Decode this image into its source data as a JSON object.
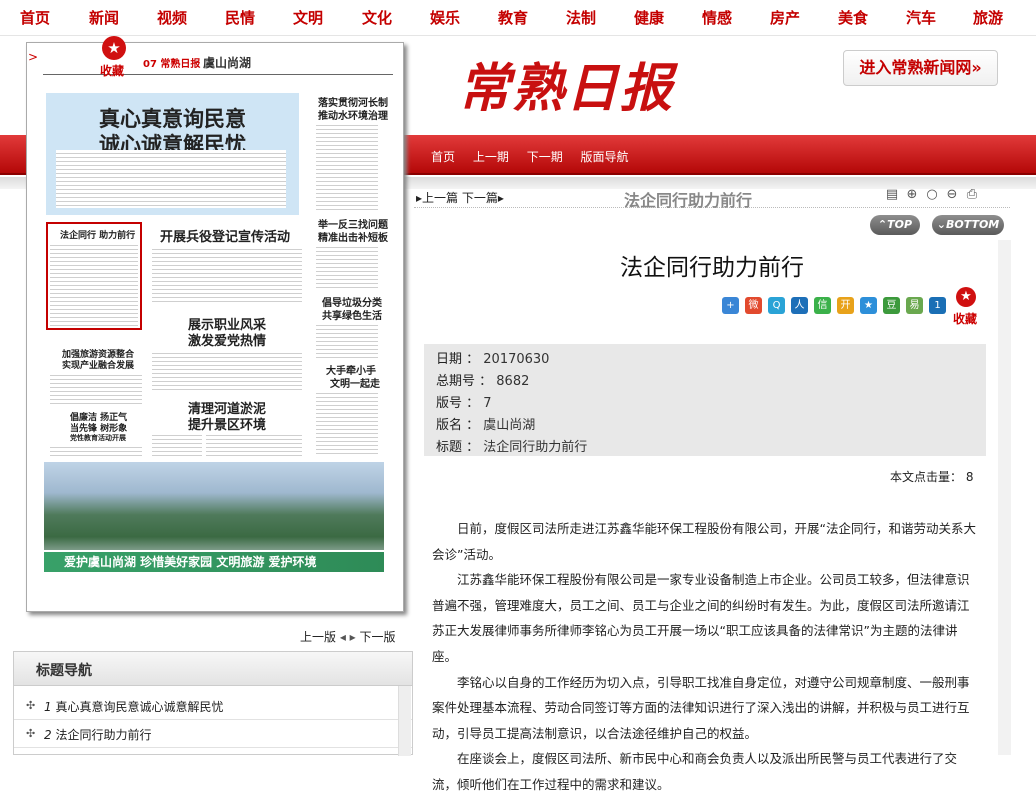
{
  "topnav": [
    "首页",
    "新闻",
    "视频",
    "民情",
    "文明",
    "文化",
    "娱乐",
    "教育",
    "法制",
    "健康",
    "情感",
    "房产",
    "美食",
    "汽车",
    "旅游"
  ],
  "masthead": "常熟日报",
  "visit_link": "进入常熟新闻网»",
  "subnav": [
    "首页",
    "上一期",
    "下一期",
    "版面导航"
  ],
  "paper": {
    "bookmark_label": "收藏",
    "page_no": "07 常熟日报",
    "page_name": "虞山尚湖",
    "lead_line1": "真心真意询民意",
    "lead_line2": "诚心诚意解民忧",
    "h_legal": "法企同行  助力前行",
    "h_enlist": "开展兵役登记宣传活动",
    "h_job1": "展示职业风采",
    "h_job2": "激发爱党热情",
    "h_river1": "清理河道淤泥",
    "h_river2": "提升景区环境",
    "h_side1a": "落实贯彻河长制",
    "h_side1b": "推动水环境治理",
    "h_side2a": "举一反三找问题",
    "h_side2b": "精准出击补短板",
    "h_side3a": "倡导垃圾分类",
    "h_side3b": "共享绿色生活",
    "h_side4a": "大手牵小手",
    "h_side4b": "文明一起走",
    "h_left1a": "加强旅游资源整合",
    "h_left1b": "实现产业融合发展",
    "h_left2a": "倡廉洁 扬正气",
    "h_left2b": "当先锋 树形象",
    "h_left2c": "党性教育活动开展",
    "banner": "爱护虞山尚湖  珍惜美好家园  文明旅游  爱护环境"
  },
  "pagenav": {
    "prev": "上一版",
    "next": "下一版"
  },
  "title_nav": {
    "heading": "标题导航",
    "items": [
      {
        "num": "1",
        "title": "真心真意询民意诚心诚意解民忧"
      },
      {
        "num": "2",
        "title": "法企同行助力前行"
      }
    ]
  },
  "article_bar": {
    "prev": "上一篇",
    "next": "下一篇",
    "subject": "法企同行助力前行"
  },
  "buttons": {
    "top": "TOP",
    "bottom": "BOTTOM"
  },
  "article": {
    "title": "法企同行助力前行",
    "bookmark_label": "收藏",
    "meta": [
      {
        "label": "日期",
        "value": "20170630"
      },
      {
        "label": "总期号",
        "value": "8682"
      },
      {
        "label": "版号",
        "value": "7"
      },
      {
        "label": "版名",
        "value": "虞山尚湖"
      },
      {
        "label": "标题",
        "value": "法企同行助力前行"
      }
    ],
    "clicks_label": "本文点击量：",
    "clicks": "8",
    "paragraphs": [
      "日前，度假区司法所走进江苏鑫华能环保工程股份有限公司，开展“法企同行，和谐劳动关系大会诊”活动。",
      "江苏鑫华能环保工程股份有限公司是一家专业设备制造上市企业。公司员工较多，但法律意识普遍不强，管理难度大，员工之间、员工与企业之间的纠纷时有发生。为此，度假区司法所邀请江苏正大发展律师事务所律师李铭心为员工开展一场以“职工应该具备的法律常识”为主题的法律讲座。",
      "李铭心以自身的工作经历为切入点，引导职工找准自身定位，对遵守公司规章制度、一般刑事案件处理基本流程、劳动合同签订等方面的法律知识进行了深入浅出的讲解，并积极与员工进行互动，引导员工提高法制意识，以合法途径维护自己的权益。",
      "在座谈会上，度假区司法所、新市民中心和商会负责人以及派出所民警与员工代表进行了交流，倾听他们在工作过程中的需求和建议。"
    ]
  },
  "colors": {
    "brand_red": "#c40000",
    "band_red": "#d02020",
    "meta_bg": "#e8e8e8"
  }
}
